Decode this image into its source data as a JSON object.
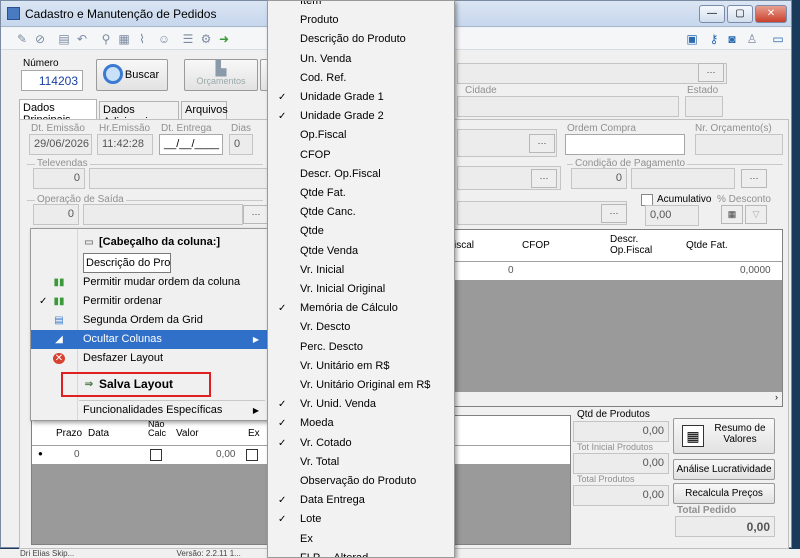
{
  "window": {
    "title": "Cadastro e Manutenção de Pedidos",
    "min": "—",
    "max": "▢",
    "close": "✕"
  },
  "header": {
    "numero_label": "Número",
    "numero_value": "114203",
    "buscar_label": "Buscar",
    "orcamentos_label": "Orçamentos",
    "cidade_label": "Cidade",
    "estado_label": "Estado"
  },
  "tabs": [
    "Dados Principais",
    "Dados Adicionais",
    "Arquivos"
  ],
  "main": {
    "dt_emissao_label": "Dt. Emissão",
    "dt_emissao": "29/06/2026",
    "hr_emissao_label": "Hr.Emissão",
    "hr_emissao": "11:42:28",
    "dt_entrega_label": "Dt. Entrega",
    "dt_entrega": "__/__/____",
    "dias_label": "Dias",
    "dias": "0",
    "ordem_compra_label": "Ordem Compra",
    "nr_orcamento_label": "Nr. Orçamento(s)",
    "televendas_label": "Televendas",
    "televendas": "0",
    "condicao_label": "Condição de Pagamento",
    "condicao": "0",
    "operacao_label": "Operação de Saída",
    "operacao": "0",
    "acumulativo_label": "Acumulativo",
    "desconto_label": "% Desconto",
    "desconto": "0,00"
  },
  "grid": {
    "headers": [
      "Icms.Fiscal",
      "CFOP",
      "Descr. Op.Fiscal",
      "Qtde Fat."
    ],
    "row": [
      "0",
      "",
      "",
      "0,0000"
    ]
  },
  "bottom_grid": {
    "headers": [
      "Prazo",
      "Data",
      "Não Calc",
      "Valor",
      "Ex"
    ],
    "row": [
      "0",
      "",
      "",
      "0,00",
      ""
    ]
  },
  "totals": {
    "qtd_produtos_label": "Qtd de Produtos",
    "qtd_produtos": "0,00",
    "tot_inicial_label": "Tot Inicial Produtos",
    "tot_inicial": "0,00",
    "total_produtos_label": "Total Produtos",
    "total_produtos": "0,00",
    "total_pedido_label": "Total Pedido",
    "total_pedido": "0,00"
  },
  "side_buttons": {
    "resumo": "Resumo de Valores",
    "analise": "Análise Lucratividade",
    "recalcula": "Recalcula Preços"
  },
  "context_menu": {
    "header": "[Cabeçalho da coluna:]",
    "input_value": "Descrição do Proc",
    "items": [
      "Permitir mudar ordem da coluna",
      "Permitir ordenar",
      "Segunda Ordem da Grid",
      "Ocultar Colunas",
      "Desfazer Layout",
      "Salva Layout",
      "Funcionalidades Específicas"
    ]
  },
  "columns_menu": [
    {
      "label": "Item",
      "checked": false
    },
    {
      "label": "Produto",
      "checked": false
    },
    {
      "label": "Descrição do Produto",
      "checked": false
    },
    {
      "label": "Un. Venda",
      "checked": false
    },
    {
      "label": "Cod. Ref.",
      "checked": false
    },
    {
      "label": "Unidade Grade 1",
      "checked": true
    },
    {
      "label": "Unidade Grade 2",
      "checked": true
    },
    {
      "label": "Op.Fiscal",
      "checked": false
    },
    {
      "label": "CFOP",
      "checked": false
    },
    {
      "label": "Descr. Op.Fiscal",
      "checked": false
    },
    {
      "label": "Qtde Fat.",
      "checked": false
    },
    {
      "label": "Qtde Canc.",
      "checked": false
    },
    {
      "label": "Qtde",
      "checked": false
    },
    {
      "label": "Qtde Venda",
      "checked": false
    },
    {
      "label": "Vr. Inicial",
      "checked": false
    },
    {
      "label": "Vr. Inicial Original",
      "checked": false
    },
    {
      "label": "Memória de Cálculo",
      "checked": true
    },
    {
      "label": "Vr. Descto",
      "checked": false
    },
    {
      "label": "Perc. Descto",
      "checked": false
    },
    {
      "label": "Vr. Unitário em R$",
      "checked": false
    },
    {
      "label": "Vr. Unitário Original em R$",
      "checked": false
    },
    {
      "label": "Vr. Unid. Venda",
      "checked": true
    },
    {
      "label": "Moeda",
      "checked": true
    },
    {
      "label": "Vr. Cotado",
      "checked": true
    },
    {
      "label": "Vr. Total",
      "checked": false
    },
    {
      "label": "Observação do Produto",
      "checked": false
    },
    {
      "label": "Data Entrega",
      "checked": true
    },
    {
      "label": "Lote",
      "checked": true
    },
    {
      "label": "Ex",
      "checked": false
    },
    {
      "label": "FLP.... Alterad...",
      "checked": false
    }
  ],
  "statusbar": {
    "left": "Dri Elias Skip...",
    "right": "Versão: 2.2.11 1..."
  },
  "colors": {
    "highlight": "#3170c8",
    "red_box": "#e02020"
  }
}
